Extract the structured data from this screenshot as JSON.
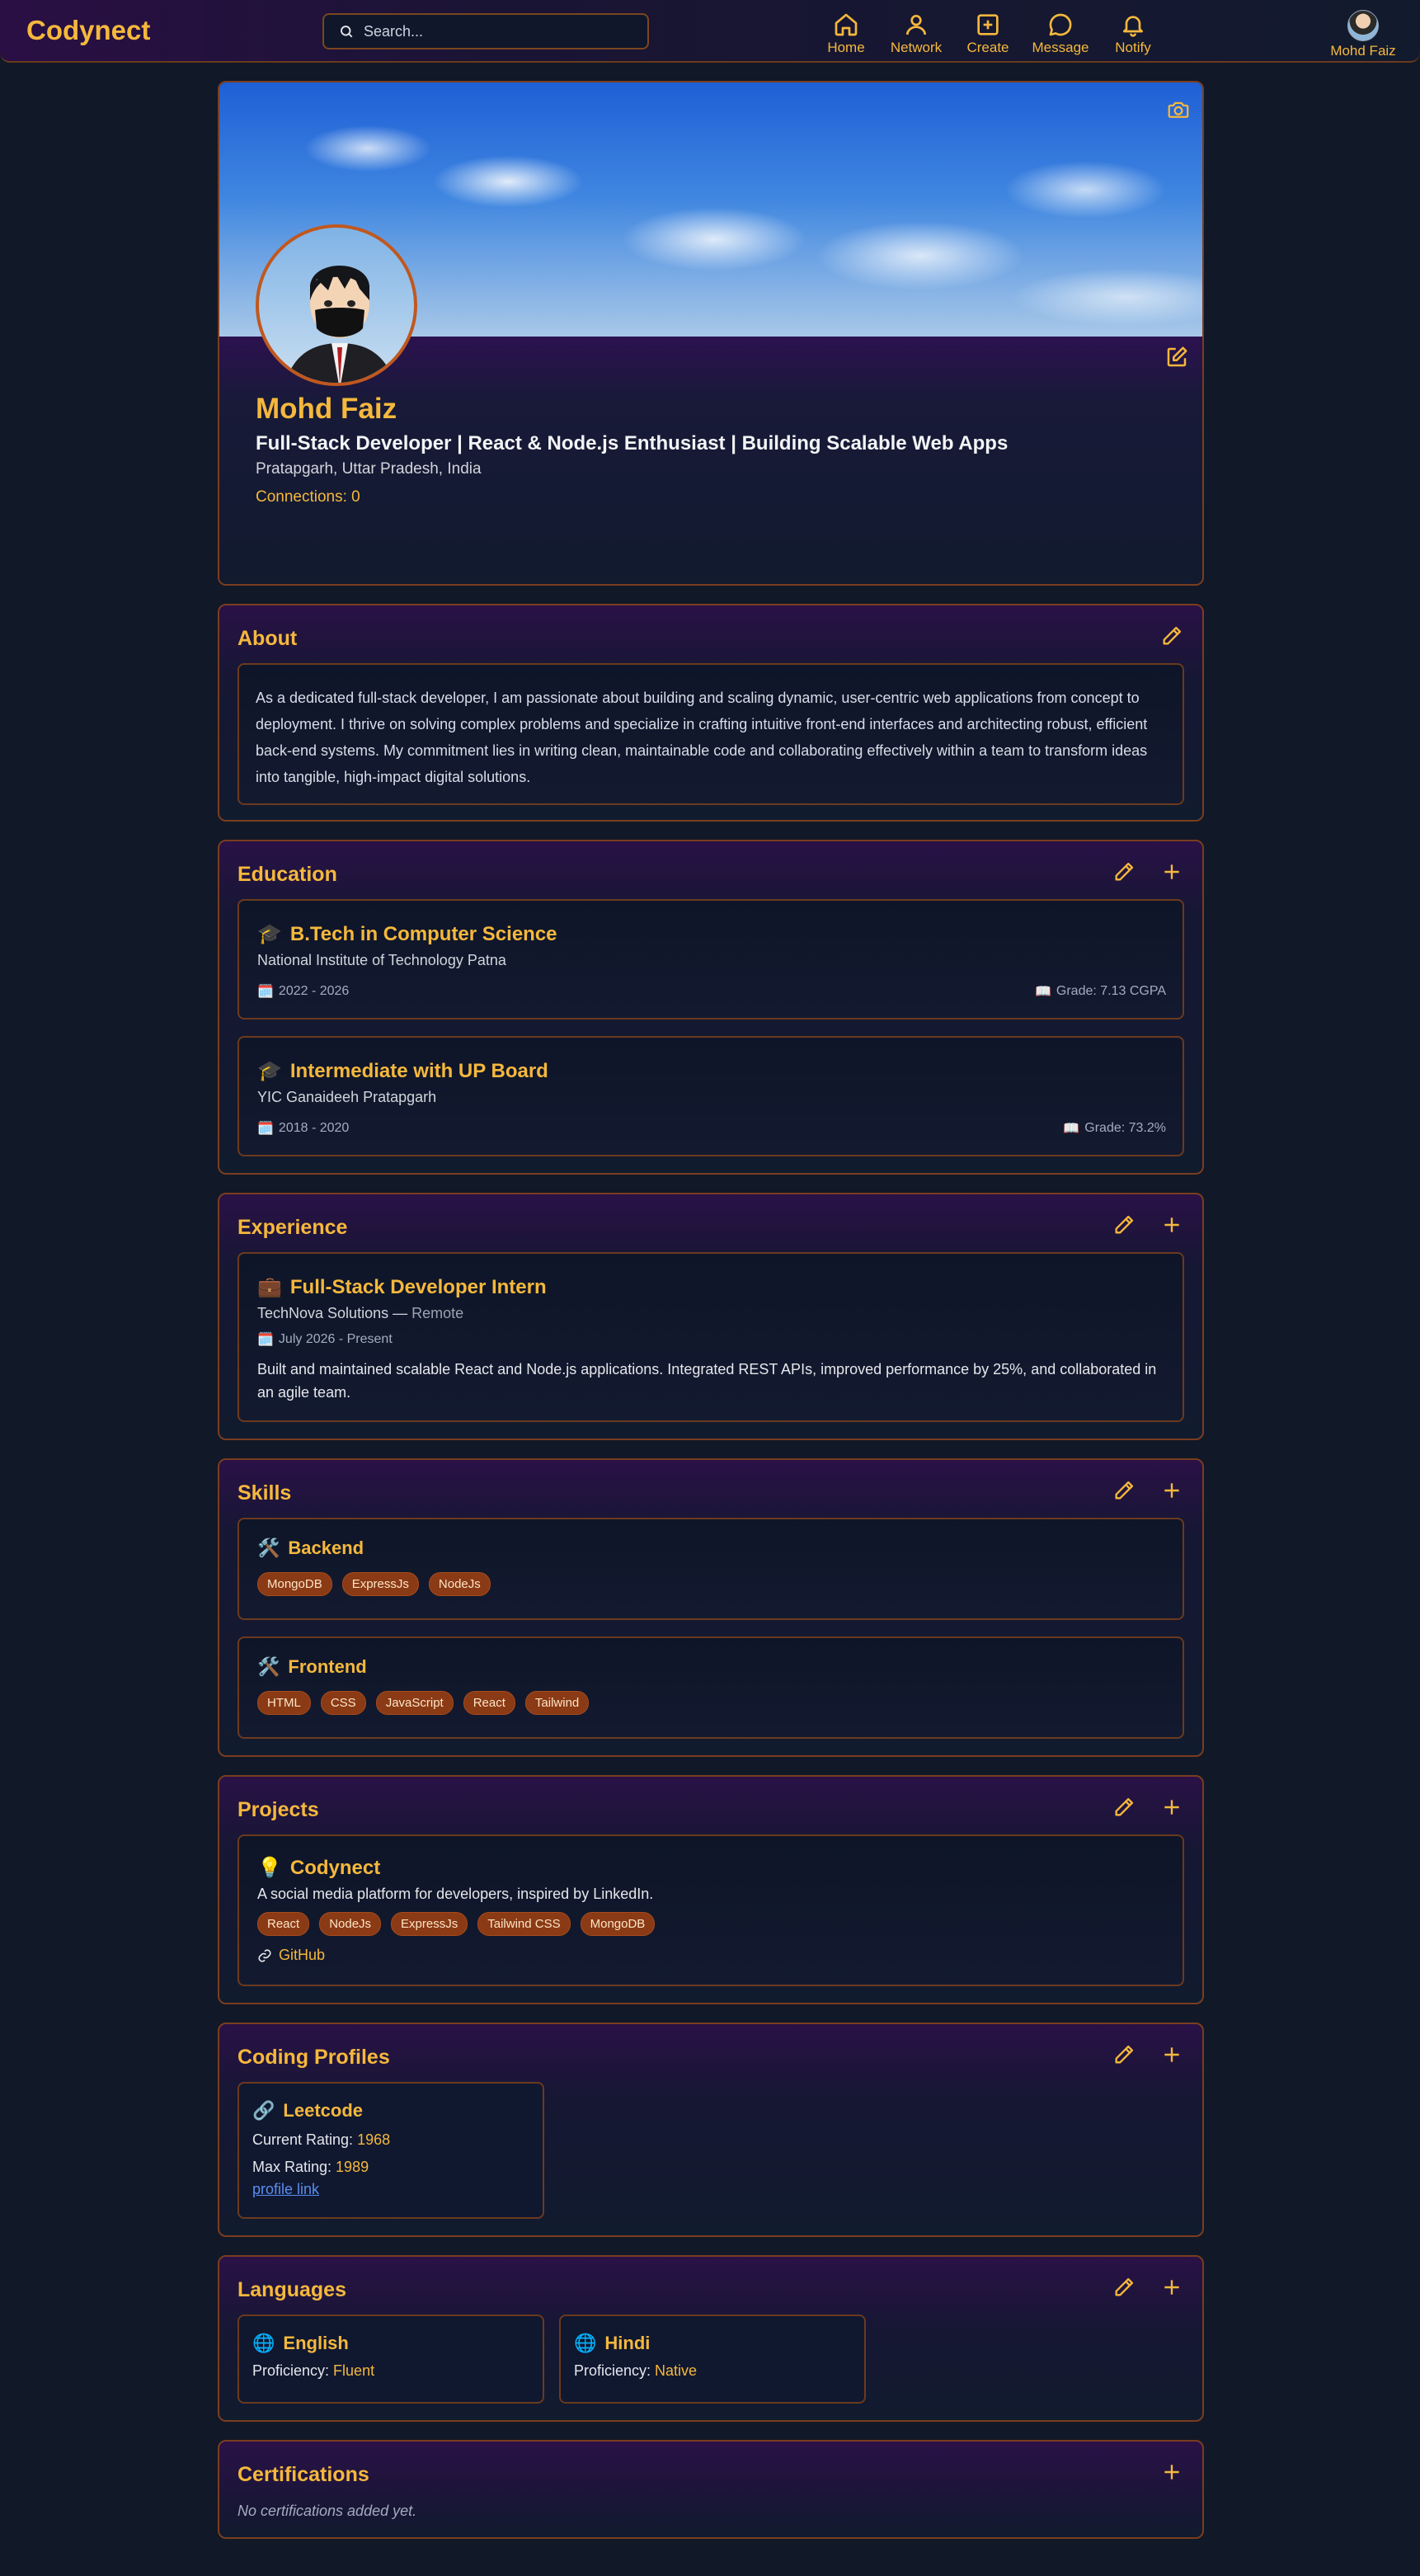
{
  "app": {
    "logo": "Codynect"
  },
  "search": {
    "placeholder": "Search..."
  },
  "nav": {
    "items": [
      {
        "label": "Home",
        "icon": "home-icon"
      },
      {
        "label": "Network",
        "icon": "user-icon"
      },
      {
        "label": "Create",
        "icon": "plus-square-icon"
      },
      {
        "label": "Message",
        "icon": "message-icon"
      },
      {
        "label": "Notify",
        "icon": "bell-icon"
      }
    ],
    "user": "Mohd Faiz"
  },
  "profile": {
    "name": "Mohd Faiz",
    "headline": "Full-Stack Developer | React & Node.js Enthusiast | Building Scalable Web Apps",
    "location": "Pratapgarh, Uttar Pradesh, India",
    "connections": "Connections: 0"
  },
  "about": {
    "title": "About",
    "text": "As a dedicated full-stack developer, I am passionate about building and scaling dynamic, user-centric web applications from concept to deployment. I thrive on solving complex problems and specialize in crafting intuitive front-end interfaces and architecting robust, efficient back-end systems. My commitment lies in writing clean, maintainable code and collaborating effectively within a team to transform ideas into tangible, high-impact digital solutions."
  },
  "education": {
    "title": "Education",
    "items": [
      {
        "degree": "B.Tech in Computer Science",
        "school": "National Institute of Technology Patna",
        "years": "2022 - 2026",
        "grade": "Grade: 7.13 CGPA"
      },
      {
        "degree": "Intermediate with UP Board",
        "school": "YIC Ganaideeh Pratapgarh",
        "years": "2018 - 2020",
        "grade": "Grade: 73.2%"
      }
    ]
  },
  "experience": {
    "title": "Experience",
    "items": [
      {
        "role": "Full-Stack Developer Intern",
        "company": "TechNova Solutions — ",
        "mode": "Remote",
        "dates": "July 2026 - Present",
        "description": "Built and maintained scalable React and Node.js applications. Integrated REST APIs, improved performance by 25%, and collaborated in an agile team."
      }
    ]
  },
  "skills": {
    "title": "Skills",
    "groups": [
      {
        "name": "Backend",
        "items": [
          "MongoDB",
          "ExpressJs",
          "NodeJs"
        ]
      },
      {
        "name": "Frontend",
        "items": [
          "HTML",
          "CSS",
          "JavaScript",
          "React",
          "Tailwind"
        ]
      }
    ]
  },
  "projects": {
    "title": "Projects",
    "items": [
      {
        "name": "Codynect",
        "description": "A social media platform for developers, inspired by LinkedIn.",
        "tags": [
          "React",
          "NodeJs",
          "ExpressJs",
          "Tailwind CSS",
          "MongoDB"
        ],
        "link": "GitHub"
      }
    ]
  },
  "coding_profiles": {
    "title": "Coding Profiles",
    "items": [
      {
        "name": "Leetcode",
        "current_label": "Current Rating: ",
        "current": "1968",
        "max_label": "Max Rating: ",
        "max": "1989",
        "link": "profile link"
      }
    ]
  },
  "languages": {
    "title": "Languages",
    "items": [
      {
        "name": "English",
        "label": "Proficiency: ",
        "level": "Fluent"
      },
      {
        "name": "Hindi",
        "label": "Proficiency: ",
        "level": "Native"
      }
    ]
  },
  "certifications": {
    "title": "Certifications",
    "empty": "No certifications added yet."
  },
  "colors": {
    "accent": "#f5b83d",
    "chip": "#8a3a14",
    "border": "#7a3d1f",
    "background": "#111827"
  }
}
